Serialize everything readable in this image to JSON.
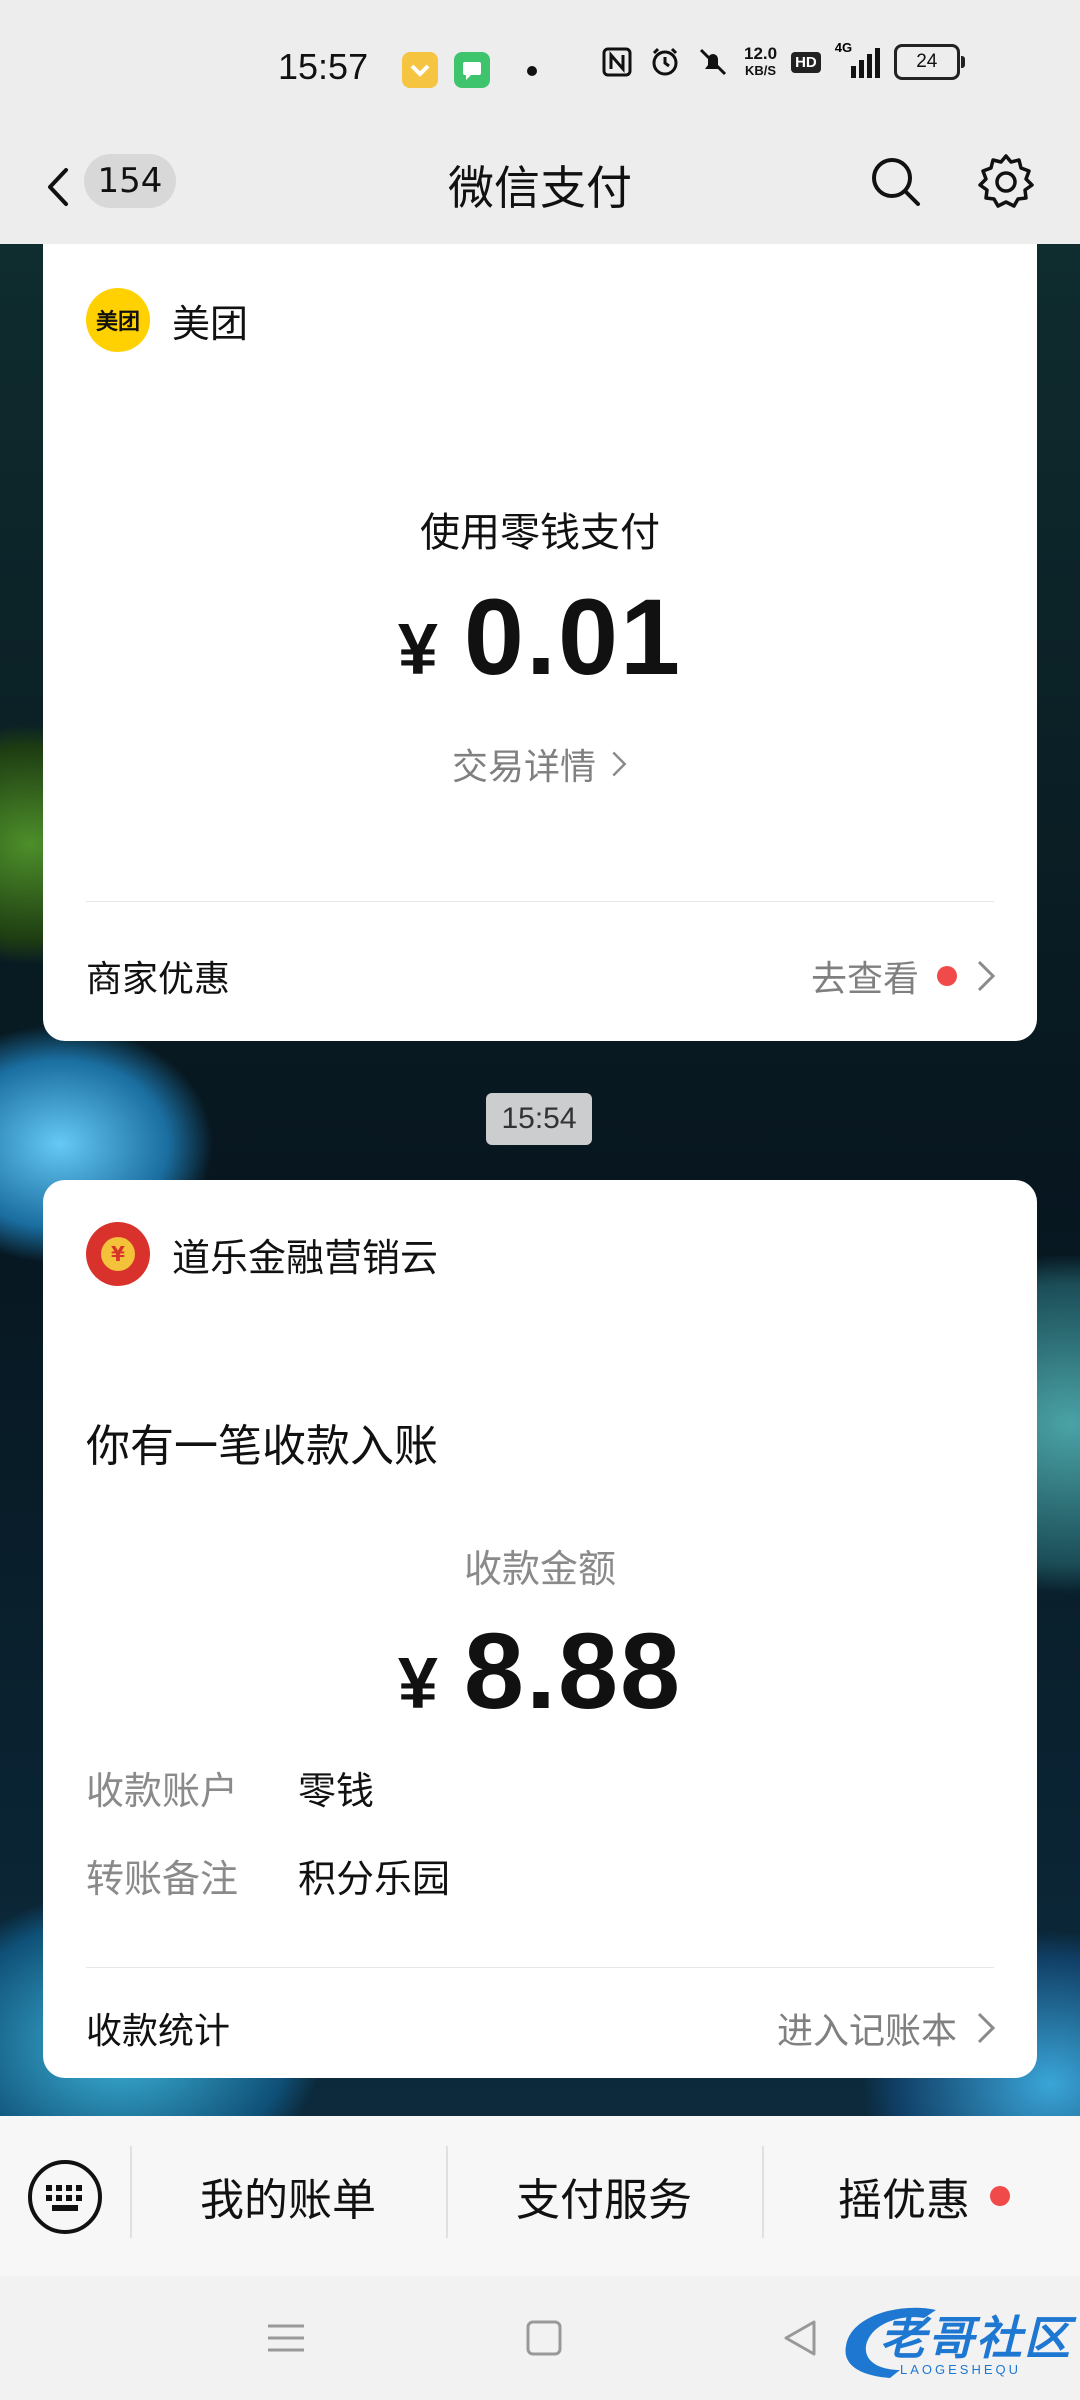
{
  "status_bar": {
    "time": "15:57",
    "net_speed_value": "12.0",
    "net_speed_unit": "KB/S",
    "hd_label": "HD",
    "network_label": "4G",
    "battery_level": "24"
  },
  "nav": {
    "unread_count": "154",
    "title": "微信支付"
  },
  "card1": {
    "merchant_logo_text": "美团",
    "merchant_name": "美团",
    "payment_method": "使用零钱支付",
    "currency_symbol": "¥",
    "amount": "0.01",
    "detail_link": "交易详情",
    "footer_left": "商家优惠",
    "footer_right": "去查看"
  },
  "time_separator": "15:54",
  "card2": {
    "merchant_logo_text": "¥",
    "merchant_name": "道乐金融营销云",
    "headline": "你有一笔收款入账",
    "amount_label": "收款金额",
    "currency_symbol": "¥",
    "amount": "8.88",
    "rows": [
      {
        "label": "收款账户",
        "value": "零钱"
      },
      {
        "label": "转账备注",
        "value": "积分乐园"
      }
    ],
    "footer_left": "收款统计",
    "footer_right": "进入记账本"
  },
  "bottom_menu": {
    "items": [
      "我的账单",
      "支付服务",
      "摇优惠"
    ]
  },
  "watermark": {
    "text": "老哥社区",
    "sub": "LAOGESHEQU"
  },
  "colors": {
    "accent_red": "#f04a4a",
    "meituan_yellow": "#ffd100",
    "watermark_blue": "#1e78d2"
  }
}
